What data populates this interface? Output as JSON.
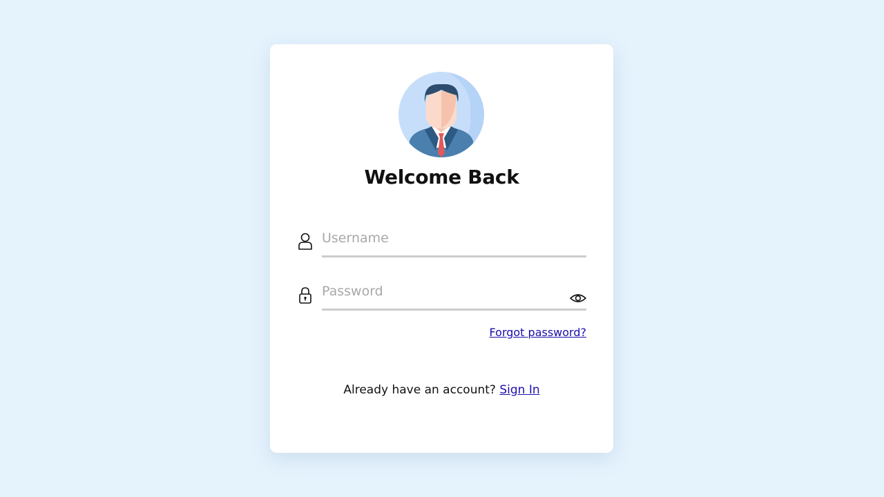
{
  "login": {
    "title": "Welcome Back",
    "username_placeholder": "Username",
    "password_placeholder": "Password",
    "forgot_password": "Forgot password?",
    "account_prompt": "Already have an account? ",
    "sign_in": "Sign In"
  },
  "icons": {
    "avatar": "user-avatar-icon",
    "username": "user-icon",
    "password": "lock-icon",
    "toggle_visibility": "eye-icon"
  },
  "colors": {
    "background": "#e5f3fd",
    "card": "#ffffff",
    "link": "#1a0dab",
    "underline": "#cccccc",
    "placeholder": "#a8a8a8"
  }
}
